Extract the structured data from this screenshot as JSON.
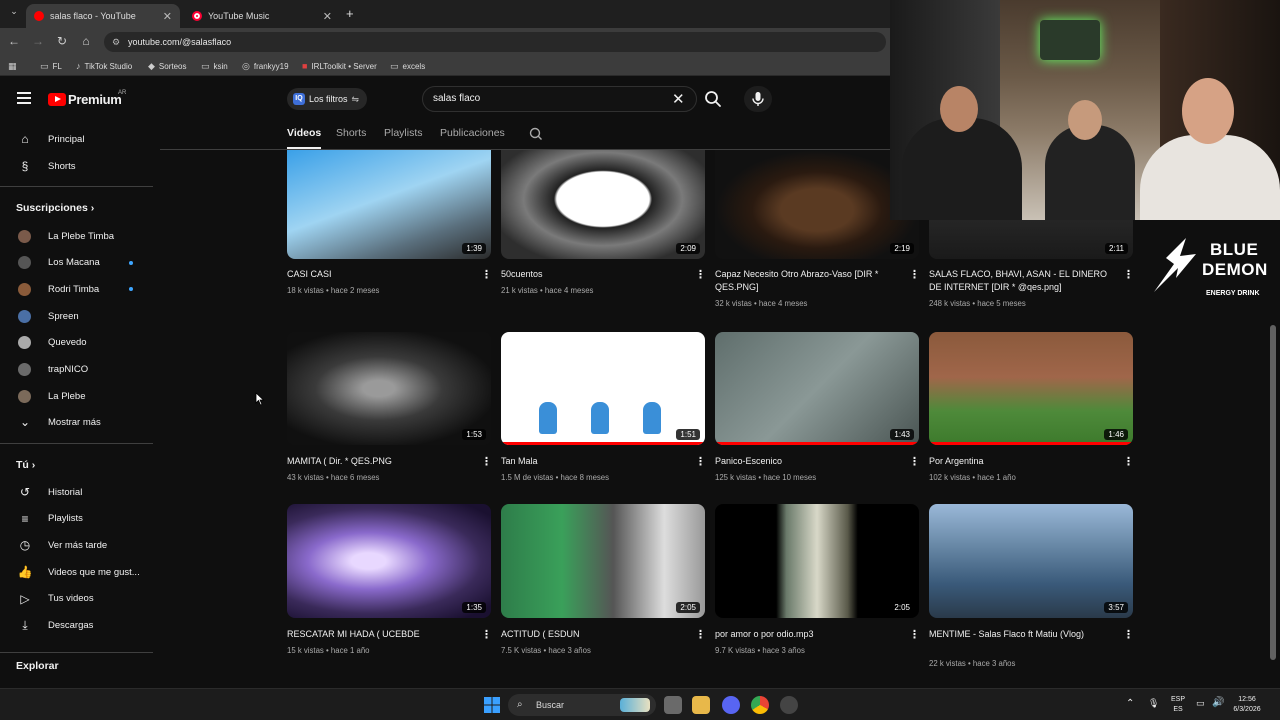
{
  "browser": {
    "tabs": [
      {
        "title": "salas flaco - YouTube",
        "active": true
      },
      {
        "title": "YouTube Music",
        "active": false
      }
    ],
    "new_tab": "+",
    "url": "youtube.com/@salasflaco",
    "bookmarks": [
      "FL",
      "TikTok Studio",
      "Sorteos",
      "ksin",
      "frankyy19",
      "IRLToolkit • Server",
      "excels"
    ]
  },
  "masthead": {
    "logo_text": "Premium",
    "country": "AR",
    "filters_label": "Los filtros",
    "search_value": "salas flaco"
  },
  "sidebar": {
    "main": [
      {
        "label": "Principal",
        "icon": "home-icon"
      },
      {
        "label": "Shorts",
        "icon": "shorts-icon"
      }
    ],
    "subscriptions_heading": "Suscripciones",
    "subscriptions": [
      {
        "label": "La Plebe Timba",
        "new": false,
        "color": "#7a5a4a"
      },
      {
        "label": "Los Macana",
        "new": true,
        "color": "#555555"
      },
      {
        "label": "Rodri Timba",
        "new": true,
        "color": "#8a5b3a"
      },
      {
        "label": "Spreen",
        "new": false,
        "color": "#4a6fa5"
      },
      {
        "label": "Quevedo",
        "new": false,
        "color": "#aaaaaa"
      },
      {
        "label": "trapNICO",
        "new": false,
        "color": "#6a6a6a"
      },
      {
        "label": "La Plebe",
        "new": false,
        "color": "#7b6a5a"
      }
    ],
    "show_more": "Mostrar más",
    "you_heading": "Tú",
    "you_items": [
      {
        "label": "Historial",
        "icon": "history-icon"
      },
      {
        "label": "Playlists",
        "icon": "playlists-icon"
      },
      {
        "label": "Ver más tarde",
        "icon": "watch-later-icon"
      },
      {
        "label": "Videos que me gust...",
        "icon": "like-icon"
      },
      {
        "label": "Tus videos",
        "icon": "your-videos-icon"
      },
      {
        "label": "Descargas",
        "icon": "downloads-icon"
      }
    ],
    "explore_heading": "Explorar"
  },
  "channel_tabs": [
    "Videos",
    "Shorts",
    "Playlists",
    "Publicaciones"
  ],
  "videos": [
    {
      "title": "CASI CASI",
      "views": "18 k vistas",
      "age": "hace 2 meses",
      "duration": "1:39",
      "bg": "linear-gradient(160deg,#3aa0e8,#9fd4f2 45%,#5a6f7d 75%,#2a2a2a)"
    },
    {
      "title": "50cuentos",
      "views": "21 k vistas",
      "age": "hace 4 meses",
      "duration": "2:09",
      "bg": "radial-gradient(ellipse at 50% 45%, #ffffff 32%, #222 34%, #7a7a7a 55%, #2e2e2e 80%)"
    },
    {
      "title": "Capaz Necesito Otro Abrazo-Vaso [DIR * QES.PNG]",
      "views": "32 k vistas",
      "age": "hace 4 meses",
      "duration": "2:19",
      "bg": "radial-gradient(ellipse at 50% 55%, #5a3a22 25%, #2a1a10 45%, #111 70%)"
    },
    {
      "title": "SALAS FLACO, BHAVI, ASAN - EL DINERO DE INTERNET [DIR * @qes.png]",
      "views": "248 k vistas",
      "age": "hace 5 meses",
      "duration": "2:11",
      "bg": "linear-gradient(180deg,#3a3a3a,#1a1a1a)"
    },
    {
      "title": "MAMITA ( Dir. * QES.PNG",
      "views": "43 k vistas",
      "age": "hace 6 meses",
      "duration": "1:53",
      "bg": "radial-gradient(ellipse at 45% 50%, #9a9a9a 10%, #3a3a3a 40%, #101010 75%)"
    },
    {
      "title": "Tan Mala",
      "views": "1.5 M de vistas",
      "age": "hace 8 meses",
      "duration": "1:51",
      "bg": "#ffffff",
      "progress": 1.0
    },
    {
      "title": "Panico-Escenico",
      "views": "125 k vistas",
      "age": "hace 10 meses",
      "duration": "1:43",
      "bg": "linear-gradient(135deg,#5f6e6c,#8a9896 50%,#4a5553)",
      "progress": 1.0
    },
    {
      "title": "Por Argentina",
      "views": "102 k vistas",
      "age": "hace 1 año",
      "duration": "1:46",
      "bg": "linear-gradient(180deg,#8b5a3c 0%,#a0664a 40%,#4e8a3a 70%,#3d7a2c 100%)",
      "progress": 1.0
    },
    {
      "title": "RESCATAR MI HADA ( UCEBDE",
      "views": "15 k vistas",
      "age": "hace 1 año",
      "duration": "1:35",
      "bg": "radial-gradient(ellipse at 40% 50%, #e8d8ff 10%, #8a6acc 35%, #3a2a5a 65%, #1a1030 90%)"
    },
    {
      "title": "ACTITUD ( ESDUN",
      "views": "7.5 K vistas",
      "age": "hace 3 años",
      "duration": "2:05",
      "bg": "linear-gradient(90deg,#2e7d4a 0%,#3aa05a 30%,#555 55%,#ddd 80%,#999 100%)"
    },
    {
      "title": "por amor o por odio.mp3",
      "views": "9.7 K vistas",
      "age": "hace 3 años",
      "duration": "2:05",
      "bg": "linear-gradient(90deg,#000 0%,#000 30%,#6a7a6a 35%,#d8d8c8 50%,#5a5a4a 65%,#000 70%,#000 100%)"
    },
    {
      "title": "MENTIME - Salas Flaco ft Matiu (Vlog)",
      "views": "22 k vistas",
      "age": "hace 3 años",
      "duration": "3:57",
      "bg": "linear-gradient(180deg,#9ab8d8 0%,#6a8aa8 35%,#3a5a7a 70%,#2a3a4a 100%)"
    }
  ],
  "promo": {
    "line1": "BLUE",
    "line2": "DEMON",
    "line3": "ENERGY DRINK"
  },
  "taskbar": {
    "search_label": "Buscar",
    "lang1": "ESP",
    "lang2": "ES",
    "time": "12:56",
    "date": "6/3/2026"
  }
}
